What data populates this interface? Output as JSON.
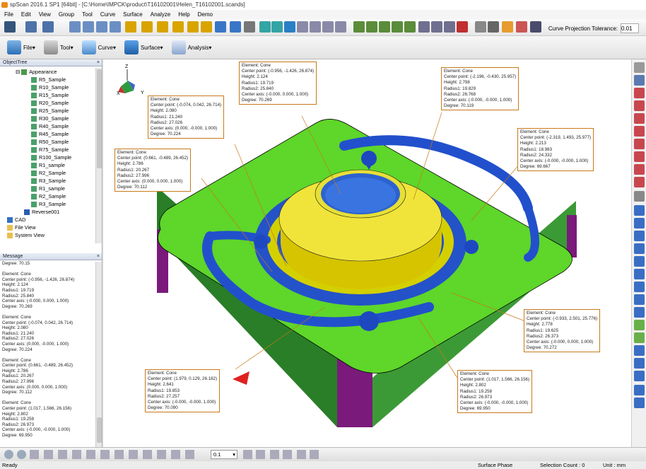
{
  "window": {
    "title": "spScan 2016.1 SP1 [64bit] - [C:\\Home\\IMPCK\\product\\T16102001\\Helen_T16102001.scands]"
  },
  "menu": [
    "File",
    "Edit",
    "View",
    "Group",
    "Tool",
    "Curve",
    "Surface",
    "Analyze",
    "Help",
    "Demo"
  ],
  "toolbar2": {
    "file": "File",
    "tool": "Tool",
    "curve": "Curve",
    "surface": "Surface",
    "analysis": "Analysis"
  },
  "tolerance": {
    "label": "Curve Projection Tolerance:",
    "value": "0.01"
  },
  "object_tree": {
    "title": "ObjectTree",
    "items": [
      "Appearance",
      "R5_Sample",
      "R10_Sample",
      "R15_Sample",
      "R20_Sample",
      "R25_Sample",
      "R30_Sample",
      "R40_Sample",
      "R45_Sample",
      "R50_Sample",
      "R75_Sample",
      "R100_Sample",
      "R1_sample",
      "R2_Sample",
      "R3_Sample",
      "R1_sample",
      "R2_Sample",
      "R3_Sample",
      "Reverse001",
      "CAD",
      "File View",
      "System View"
    ]
  },
  "message": {
    "title": "Message",
    "text": "Degree: 70.15\n\nElement: Cone\nCenter point: (-0.956, -1.426, 26.874)\nHeight: 2.124\nRadius1: 19.719\nRadius2: 25.840\nCenter axis: (-0.000, 0.000, 1.000)\nDegree: 70.269\n\nElement: Cone\nCenter point: (-0.074, 0.042, 26.714)\nHeight: 2.080\nRadius1: 21.240\nRadius2: 27.026\nCenter axis: (0.000, -0.000, 1.000)\nDegree: 70.224\n\nElement: Cone\nCenter point: (0.661, -0.489, 26.452)\nHeight: 2.786\nRadius1: 20.267\nRadius2: 27.996\nCenter axis: (0.000, 0.000, 1.000)\nDegree: 70.112\n\nElement: Cone\nCenter point: (1.017, 1.566, 26.156)\nHeight: 2.802\nRadius1: 19.258\nRadius2: 26.973\nCenter axis: (-0.000, -0.000, 1.000)\nDegree: 69.950"
  },
  "callouts": [
    {
      "text": "Element: Cone\nCenter point: (-0.956, -1.426, 26.874)\nHeight: 2.124\nRadius1: 19.719\nRadius2: 25.840\nCenter axis: (-0.000, 0.000, 1.000)\nDegree: 70.269"
    },
    {
      "text": "Element: Cone\nCenter point: (-2.196, -0.430, 25.957)\nHeight: 2.798\nRadius1: 19.829\nRadius2: 26.768\nCenter axis: (-0.000, -0.000, 1.000)\nDegree: 70.119"
    },
    {
      "text": "Element: Cone\nCenter point: (-0.074, 0.042, 26.714)\nHeight: 2.080\nRadius1: 21.240\nRadius2: 27.026\nCenter axis: (0.000, -0.000, 1.000)\nDegree: 70.224"
    },
    {
      "text": "Element: Cone\nCenter point: (-2.319, 1.493, 25.977)\nHeight: 2.213\nRadius1: 18.983\nRadius2: 24.332\nCenter axis: (-0.000, -0.000, 1.000)\nDegree: 69.667"
    },
    {
      "text": "Element: Cone\nCenter point: (0.661, -0.489, 26.452)\nHeight: 2.786\nRadius1: 20.267\nRadius2: 27.996\nCenter axis: (0.000, 0.000, 1.000)\nDegree: 70.112"
    },
    {
      "text": "Element: Cone\nCenter point: (-0.933, 2.501, 25.776)\nHeight: 2.778\nRadius1: 19.625\nRadius2: 26.373\nCenter axis: (-0.000, 0.000, 1.000)\nDegree: 70.272"
    },
    {
      "text": "Element: Cone\nCenter point: (1.979, 0.129, 26.182)\nHeight: 2.641\nRadius1: 19.853\nRadius2: 27.257\nCenter axis: (-0.000, -0.000, 1.000)\nDegree: 70.090"
    },
    {
      "text": "Element: Cone\nCenter point: (1.017, 1.566, 26.156)\nHeight: 2.802\nRadius1: 19.258\nRadius2: 26.973\nCenter axis: (-0.000, -0.000, 1.000)\nDegree: 69.950"
    }
  ],
  "view_dropdown": {
    "value": "0.1"
  },
  "status": {
    "left": "Ready",
    "phase": "Surface Phase",
    "selection": "Selection Count : 0",
    "unit": "Unit : mm"
  }
}
